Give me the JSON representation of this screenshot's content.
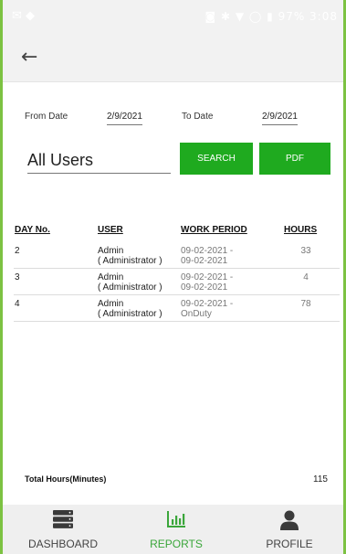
{
  "status_bar": {
    "left_icons": "✉ ◆",
    "right": "◙ ✱ ▼ ◯ ▮ 97% 3:08"
  },
  "filters": {
    "from_label": "From Date",
    "from_value": "2/9/2021",
    "to_label": "To Date",
    "to_value": "2/9/2021",
    "user_value": "All Users",
    "search_label": "SEARCH",
    "pdf_label": "PDF"
  },
  "table": {
    "headers": [
      "DAY No.",
      "USER",
      "WORK PERIOD",
      "HOURS"
    ],
    "rows": [
      {
        "day": "2",
        "user_name": "Admin",
        "user_role": "( Administrator )",
        "period_start": "09-02-2021 -",
        "period_end": "09-02-2021",
        "hours": "33"
      },
      {
        "day": "3",
        "user_name": "Admin",
        "user_role": "( Administrator )",
        "period_start": "09-02-2021 -",
        "period_end": "09-02-2021",
        "hours": "4"
      },
      {
        "day": "4",
        "user_name": "Admin",
        "user_role": "( Administrator )",
        "period_start": "09-02-2021 -",
        "period_end": "OnDuty",
        "hours": "78"
      }
    ]
  },
  "total": {
    "label": "Total Hours(Minutes)",
    "value": "115"
  },
  "nav": [
    {
      "label": "DASHBOARD",
      "icon": "dashboard-icon",
      "active": false
    },
    {
      "label": "REPORTS",
      "icon": "reports-chart-icon",
      "active": true
    },
    {
      "label": "PROFILE",
      "icon": "profile-person-icon",
      "active": false
    }
  ],
  "colors": {
    "accent": "#1faa1f",
    "frame": "#7cc242",
    "active_nav": "#3aa63a"
  }
}
